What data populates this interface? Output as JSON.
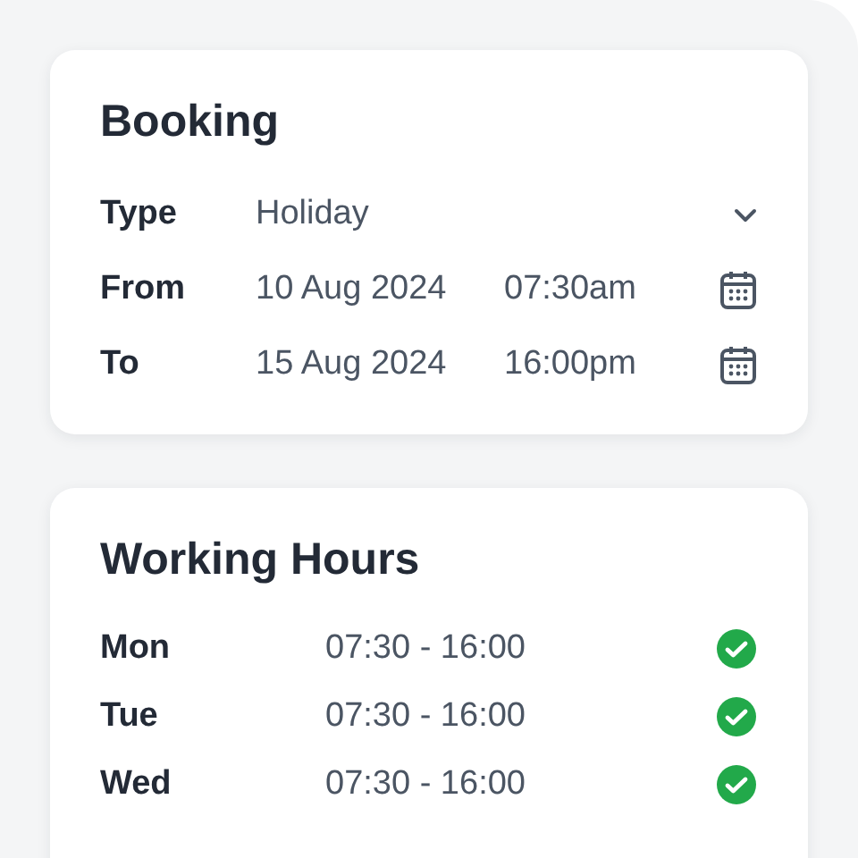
{
  "booking": {
    "title": "Booking",
    "fields": [
      {
        "kind": "select",
        "label": "Type",
        "value": "Holiday"
      },
      {
        "kind": "datetime",
        "label": "From",
        "date": "10 Aug 2024",
        "time": "07:30am"
      },
      {
        "kind": "datetime",
        "label": "To",
        "date": "15 Aug 2024",
        "time": "16:00pm"
      }
    ]
  },
  "working_hours": {
    "title": "Working Hours",
    "days": [
      {
        "day": "Mon",
        "hours": "07:30 - 16:00",
        "checked": true
      },
      {
        "day": "Tue",
        "hours": "07:30 - 16:00",
        "checked": true
      },
      {
        "day": "Wed",
        "hours": "07:30 - 16:00",
        "checked": true
      }
    ]
  }
}
